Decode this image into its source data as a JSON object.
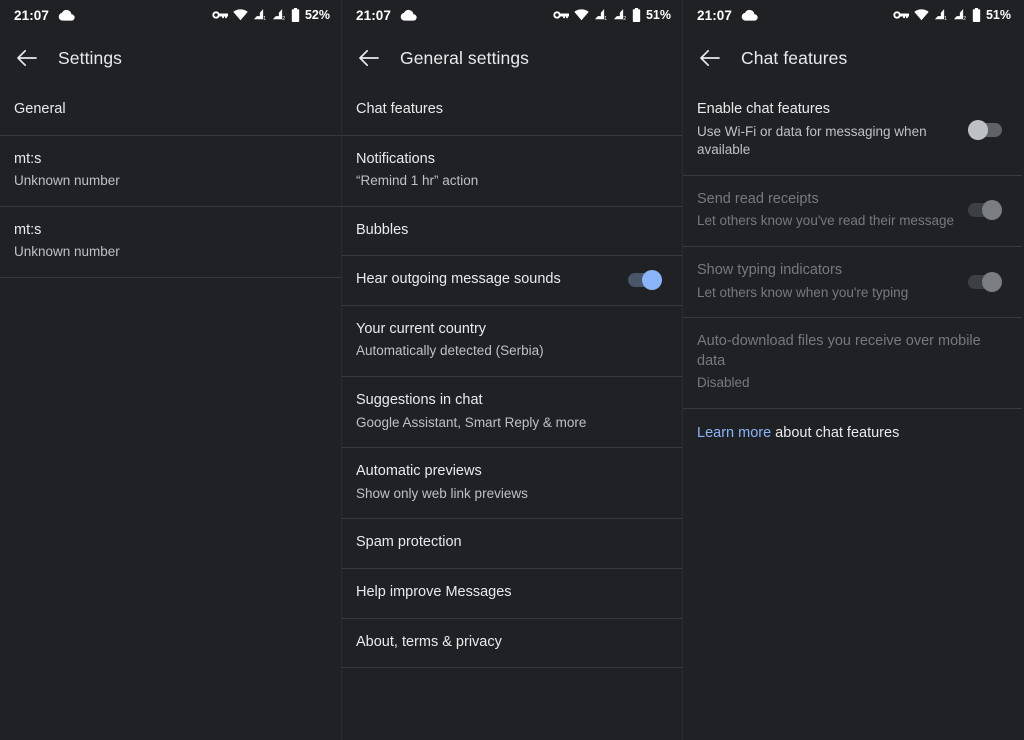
{
  "panels": [
    {
      "status": {
        "time": "21:07",
        "cloud_icon": "cloud-icon",
        "vpn_icon": "vpn-key-icon",
        "wifi_icon": "wifi-icon",
        "signal1_icon": "signal-bars-icon",
        "signal2_icon": "signal-bars-icon",
        "battery_icon": "battery-icon",
        "battery": "52%"
      },
      "appbar": {
        "back_icon": "back-arrow-icon",
        "title": "Settings"
      },
      "rows": [
        {
          "title": "General",
          "sub": ""
        },
        {
          "title": "mt:s",
          "sub": "Unknown number"
        },
        {
          "title": "mt:s",
          "sub": "Unknown number"
        }
      ]
    },
    {
      "status": {
        "time": "21:07",
        "cloud_icon": "cloud-icon",
        "vpn_icon": "vpn-key-icon",
        "wifi_icon": "wifi-icon",
        "signal1_icon": "signal-bars-icon",
        "signal2_icon": "signal-bars-icon",
        "battery_icon": "battery-icon",
        "battery": "51%"
      },
      "appbar": {
        "back_icon": "back-arrow-icon",
        "title": "General settings"
      },
      "rows": [
        {
          "title": "Chat features",
          "sub": ""
        },
        {
          "title": "Notifications",
          "sub": "“Remind 1 hr” action"
        },
        {
          "title": "Bubbles",
          "sub": ""
        },
        {
          "title": "Hear outgoing message sounds",
          "sub": "",
          "toggle": "on-blue"
        },
        {
          "title": "Your current country",
          "sub": "Automatically detected (Serbia)"
        },
        {
          "title": "Suggestions in chat",
          "sub": "Google Assistant, Smart Reply & more"
        },
        {
          "title": "Automatic previews",
          "sub": "Show only web link previews"
        },
        {
          "title": "Spam protection",
          "sub": ""
        },
        {
          "title": "Help improve Messages",
          "sub": ""
        },
        {
          "title": "About, terms & privacy",
          "sub": ""
        }
      ]
    },
    {
      "status": {
        "time": "21:07",
        "cloud_icon": "cloud-icon",
        "vpn_icon": "vpn-key-icon",
        "wifi_icon": "wifi-icon",
        "signal1_icon": "signal-bars-icon",
        "signal2_icon": "signal-bars-icon",
        "battery_icon": "battery-icon",
        "battery": "51%"
      },
      "appbar": {
        "back_icon": "back-arrow-icon",
        "title": "Chat features"
      },
      "rows": [
        {
          "title": "Enable chat features",
          "sub": "Use Wi-Fi or data for messaging when available",
          "toggle": "off"
        },
        {
          "title": "Send read receipts",
          "sub": "Let others know you've read their message",
          "toggle": "on-grey",
          "disabled": true
        },
        {
          "title": "Show typing indicators",
          "sub": "Let others know when you're typing",
          "toggle": "on-grey",
          "disabled": true
        },
        {
          "title": "Auto-download files you receive over mobile data",
          "sub": "Disabled",
          "disabled": true
        }
      ],
      "link_row": {
        "link_text": "Learn more",
        "rest_text": " about chat features"
      }
    }
  ],
  "colors": {
    "background": "#202124",
    "text_primary": "#e8eaed",
    "text_secondary": "#bdc1c6",
    "text_disabled": "#76797d",
    "divider": "#37393d",
    "accent_blue": "#8ab4f8",
    "toggle_off_thumb": "#bdc1c6",
    "toggle_disabled_thumb": "#7a7d81"
  }
}
